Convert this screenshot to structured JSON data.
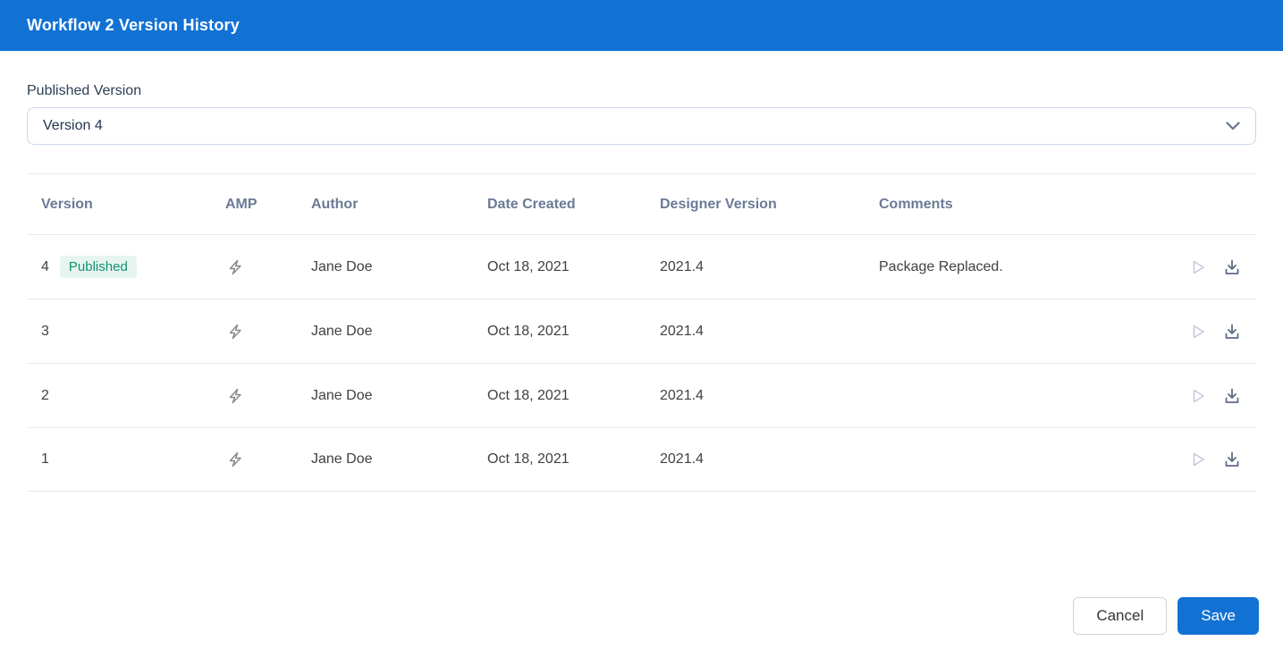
{
  "dialog": {
    "title": "Workflow 2 Version History"
  },
  "published_version": {
    "label": "Published Version",
    "selected_option": "Version 4"
  },
  "table": {
    "columns": [
      "Version",
      "AMP",
      "Author",
      "Date Created",
      "Designer Version",
      "Comments"
    ],
    "rows": [
      {
        "version": "4",
        "badge": "Published",
        "amp": "lightning-icon",
        "author": "Jane Doe",
        "date_created": "Oct 18, 2021",
        "designer_version": "2021.4",
        "comments": "Package Replaced."
      },
      {
        "version": "3",
        "badge": "",
        "amp": "lightning-icon",
        "author": "Jane Doe",
        "date_created": "Oct 18, 2021",
        "designer_version": "2021.4",
        "comments": ""
      },
      {
        "version": "2",
        "badge": "",
        "amp": "lightning-icon",
        "author": "Jane Doe",
        "date_created": "Oct 18, 2021",
        "designer_version": "2021.4",
        "comments": ""
      },
      {
        "version": "1",
        "badge": "",
        "amp": "lightning-icon",
        "author": "Jane Doe",
        "date_created": "Oct 18, 2021",
        "designer_version": "2021.4",
        "comments": ""
      }
    ],
    "row_action_icons": [
      "play-icon",
      "download-icon"
    ]
  },
  "footer": {
    "cancel_label": "Cancel",
    "save_label": "Save"
  },
  "colors": {
    "titlebar_bg": "#1272d4",
    "save_bg": "#1272d4",
    "badge_bg": "#e7f5ef",
    "badge_text": "#0f9171",
    "table_header_text": "#6b7a96",
    "cell_text": "#414141",
    "divider": "#e9e9e9",
    "select_border": "#ccd7e8",
    "play_icon": "#c3cad8",
    "download_icon": "#5d6b84",
    "lightning_icon": "#8a8a8a"
  }
}
